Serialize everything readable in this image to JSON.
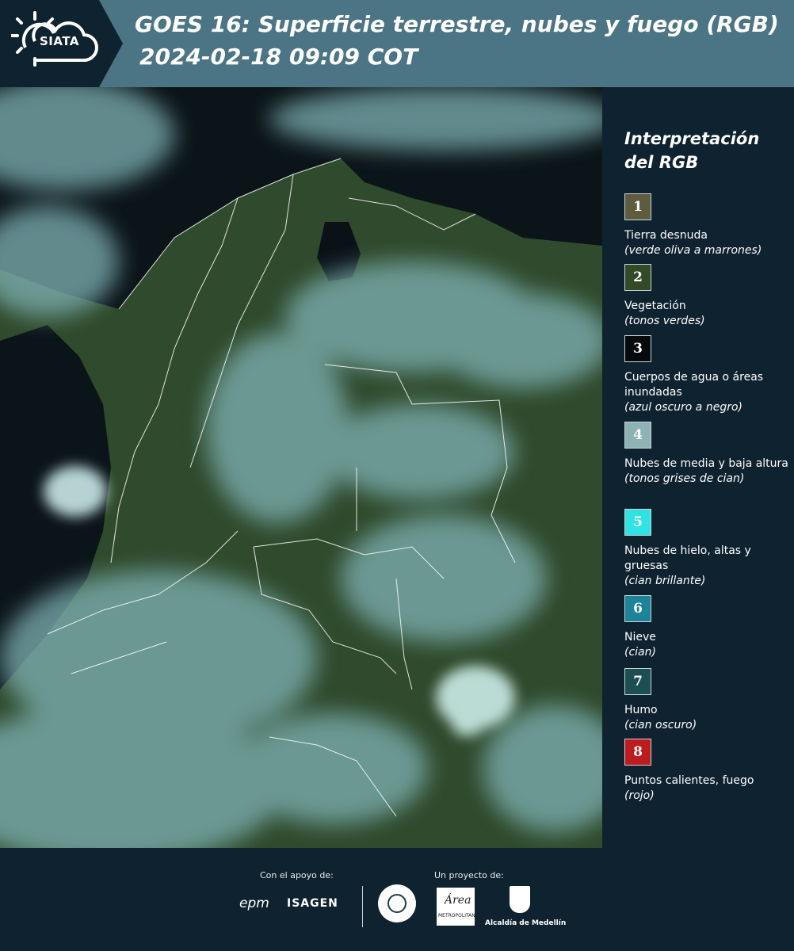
{
  "header": {
    "logo_text": "SIATA",
    "title_line1": "GOES 16: Superficie terrestre, nubes y fuego (RGB)",
    "title_line2": "2024-02-18 09:09 COT"
  },
  "legend": {
    "heading": "Interpretación del RGB",
    "items": [
      {
        "number": "1",
        "label": "Tierra desnuda",
        "desc": "(verde oliva a marrones)",
        "color": "#5e5b3e"
      },
      {
        "number": "2",
        "label": "Vegetación",
        "desc": "(tonos verdes)",
        "color": "#334a26"
      },
      {
        "number": "3",
        "label": "Cuerpos de agua o áreas inundadas",
        "desc": "(azul oscuro a negro)",
        "color": "#070a0d"
      },
      {
        "number": "4",
        "label": "Nubes de media y baja altura",
        "desc": "(tonos grises de cian)",
        "color": "#8fb3b4"
      },
      {
        "number": "5",
        "label": "Nubes de hielo, altas y gruesas",
        "desc": "(cian brillante)",
        "color": "#2ee3e1"
      },
      {
        "number": "6",
        "label": "Nieve",
        "desc": "(cian)",
        "color": "#1c8398"
      },
      {
        "number": "7",
        "label": "Humo",
        "desc": "(cian oscuro)",
        "color": "#1d4f52"
      },
      {
        "number": "8",
        "label": "Puntos calientes, fuego",
        "desc": "(rojo)",
        "color": "#be1b1f"
      }
    ]
  },
  "footer": {
    "support_caption": "Con el apoyo de:",
    "project_caption": "Un proyecto de:",
    "epm_logo": "epm",
    "isagen_logo": "ISAGEN",
    "metro_script": "Área",
    "metro_text": "METROPOLITANA",
    "medellin_text": "Alcaldía de Medellín"
  },
  "colors": {
    "header_bar": "#4b7484",
    "background": "#0f2230",
    "vegetation": "#2f4a2c",
    "cloud_cyan": "#9fd8d8",
    "sea": "#0a1218"
  }
}
